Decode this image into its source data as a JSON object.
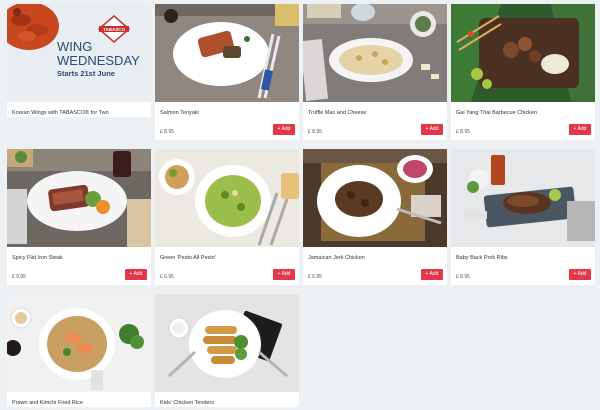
{
  "colors": {
    "background": "#eef1f3",
    "card": "#ffffff",
    "add_button": "#e4374a",
    "promo_text": "#2a4a73"
  },
  "promo": {
    "line1": "WING",
    "line2": "WEDNESDAY",
    "line3": "Starts 21st June",
    "logo_text": "TABASCO"
  },
  "menu": [
    {
      "name": "Korean Wings with TABASCO® for Two",
      "price": "",
      "add_label": ""
    },
    {
      "name": "Salmon Teriyaki",
      "price": "£ 8.95",
      "add_label": "+ Add"
    },
    {
      "name": "Truffle Mac and Cheese",
      "price": "£ 8.95",
      "add_label": "+ Add"
    },
    {
      "name": "Gai Yang Thai Barbecue Chicken",
      "price": "£ 8.95",
      "add_label": "+ Add"
    },
    {
      "name": "Spicy Flat Iron Steak",
      "price": "£ 9.95",
      "add_label": "+ Add"
    },
    {
      "name": "Green 'Pesto All Pesto'",
      "price": "£ 6.95",
      "add_label": "+ Add"
    },
    {
      "name": "Jamaican Jerk Chicken",
      "price": "£ 6.95",
      "add_label": "+ Add"
    },
    {
      "name": "Baby Back Pork Ribs",
      "price": "£ 8.95",
      "add_label": "+ Add"
    },
    {
      "name": "Prawn and Kimchi Fried Rice",
      "price": "",
      "add_label": ""
    },
    {
      "name": "Kids' Chicken Tenders",
      "price": "",
      "add_label": ""
    }
  ]
}
